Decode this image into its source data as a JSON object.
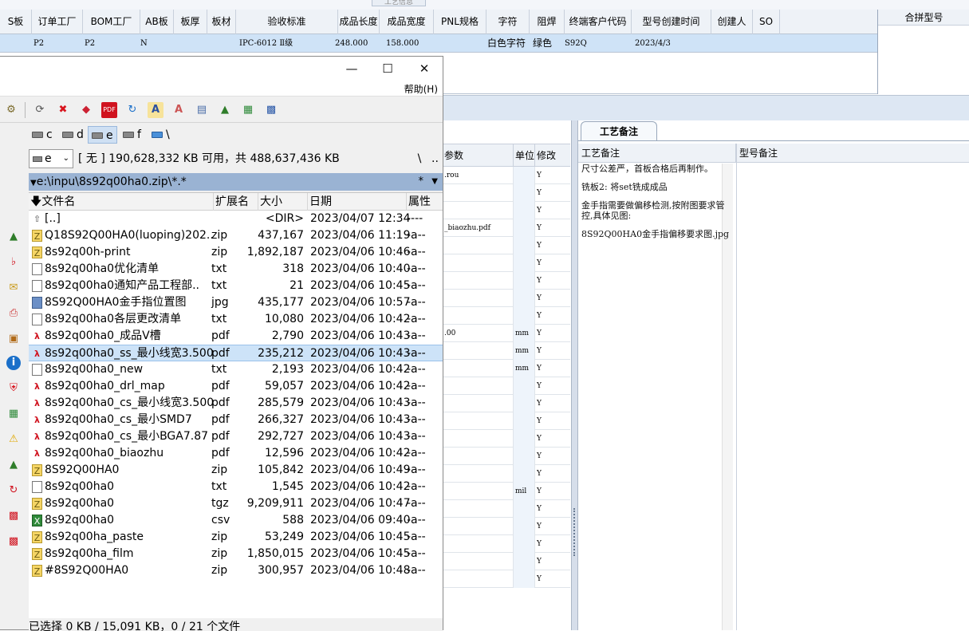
{
  "erp": {
    "top_tab": "工艺信息",
    "headers": [
      {
        "label": "S板"
      },
      {
        "label": "订单工厂"
      },
      {
        "label": "BOM工厂"
      },
      {
        "label": "AB板"
      },
      {
        "label": "板厚"
      },
      {
        "label": "板材"
      },
      {
        "label": "验收标准"
      },
      {
        "label": "成品长度"
      },
      {
        "label": "成品宽度"
      },
      {
        "label": "PNL规格"
      },
      {
        "label": "字符"
      },
      {
        "label": "阻焊"
      },
      {
        "label": "终端客户代码"
      },
      {
        "label": "型号创建时间"
      },
      {
        "label": "创建人"
      },
      {
        "label": "SO"
      }
    ],
    "row": [
      "P2",
      "P2",
      "N",
      "IPC-6012 Ⅱ级",
      "248.000",
      "158.000",
      "白色字符",
      "绿色",
      "S92Q",
      "2023/4/3"
    ],
    "merge_title": "合拼型号",
    "param_headers": {
      "param": "参数",
      "unit": "单位",
      "modify": "修改"
    },
    "param_rows": [
      {
        "p": ".rou",
        "u": "",
        "m": "Y"
      },
      {
        "p": "",
        "u": "",
        "m": "Y"
      },
      {
        "p": "",
        "u": "",
        "m": "Y"
      },
      {
        "p": "_biaozhu.pdf",
        "u": "",
        "m": "Y"
      },
      {
        "p": "",
        "u": "",
        "m": "Y"
      },
      {
        "p": "",
        "u": "",
        "m": "Y"
      },
      {
        "p": "",
        "u": "",
        "m": "Y"
      },
      {
        "p": "",
        "u": "",
        "m": "Y"
      },
      {
        "p": "",
        "u": "",
        "m": "Y"
      },
      {
        "p": ".00",
        "u": "mm",
        "m": "Y"
      },
      {
        "p": "",
        "u": "mm",
        "m": "Y"
      },
      {
        "p": "",
        "u": "mm",
        "m": "Y"
      },
      {
        "p": "",
        "u": "",
        "m": "Y"
      },
      {
        "p": "",
        "u": "",
        "m": "Y"
      },
      {
        "p": "",
        "u": "",
        "m": "Y"
      },
      {
        "p": "",
        "u": "",
        "m": "Y"
      },
      {
        "p": "",
        "u": "",
        "m": "Y"
      },
      {
        "p": "",
        "u": "",
        "m": "Y"
      },
      {
        "p": "",
        "u": "mil",
        "m": "Y"
      },
      {
        "p": "",
        "u": "",
        "m": "Y"
      },
      {
        "p": "",
        "u": "",
        "m": "Y"
      },
      {
        "p": "",
        "u": "",
        "m": "Y"
      },
      {
        "p": "",
        "u": "",
        "m": "Y"
      },
      {
        "p": "",
        "u": "",
        "m": "Y"
      }
    ],
    "notes_tab": "工艺备注",
    "notes_col1": "工艺备注",
    "notes_col2": "型号备注",
    "notes": [
      "尺寸公差严，首板合格后再制作。",
      "铣板2: 将set铣成成品",
      "金手指需要做偏移检测,按附图要求管控,具体见图:",
      "8S92Q00HA0金手指偏移要求图.jpg"
    ]
  },
  "tc": {
    "menu_help": "帮助(H)",
    "drives": [
      {
        "label": "c",
        "active": false
      },
      {
        "label": "d",
        "active": false
      },
      {
        "label": "e",
        "active": true
      },
      {
        "label": "f",
        "active": false
      },
      {
        "label": "\\",
        "active": false
      }
    ],
    "drive_select": "e",
    "free_space": "[ 无 ]  190,628,332 KB 可用，共 488,637,436 KB",
    "root_label": "\\",
    "up_label": "..",
    "path": "e:\\inpu\\8s92q00ha0.zip\\*.*",
    "history_label": "*",
    "columns": {
      "name": "文件名",
      "ext": "扩展名",
      "size": "大小",
      "date": "日期",
      "attr": "属性"
    },
    "files": [
      {
        "icon": "up",
        "name": "[..]",
        "ext": "",
        "size": "<DIR>",
        "date": "2023/04/07 12:34",
        "attr": "----",
        "selected": false
      },
      {
        "icon": "zip",
        "name": "Q18S92Q00HA0(luoping)202..",
        "ext": "zip",
        "size": "437,167",
        "date": "2023/04/06 11:19",
        "attr": "-a--",
        "selected": false
      },
      {
        "icon": "zip",
        "name": "8s92q00h-print",
        "ext": "zip",
        "size": "1,892,187",
        "date": "2023/04/06 10:46",
        "attr": "-a--",
        "selected": false
      },
      {
        "icon": "txt",
        "name": "8s92q00ha0优化清单",
        "ext": "txt",
        "size": "318",
        "date": "2023/04/06 10:40",
        "attr": "-a--",
        "selected": false
      },
      {
        "icon": "txt",
        "name": "8s92q00ha0通知产品工程部..",
        "ext": "txt",
        "size": "21",
        "date": "2023/04/06 10:45",
        "attr": "-a--",
        "selected": false
      },
      {
        "icon": "jpg",
        "name": "8S92Q00HA0金手指位置图",
        "ext": "jpg",
        "size": "435,177",
        "date": "2023/04/06 10:57",
        "attr": "-a--",
        "selected": false
      },
      {
        "icon": "txt",
        "name": "8s92q00ha0各层更改清单",
        "ext": "txt",
        "size": "10,080",
        "date": "2023/04/06 10:42",
        "attr": "-a--",
        "selected": false
      },
      {
        "icon": "pdf",
        "name": "8s92q00ha0_成品V槽",
        "ext": "pdf",
        "size": "2,790",
        "date": "2023/04/06 10:43",
        "attr": "-a--",
        "selected": false
      },
      {
        "icon": "pdf",
        "name": "8s92q00ha0_ss_最小线宽3.500",
        "ext": "pdf",
        "size": "235,212",
        "date": "2023/04/06 10:43",
        "attr": "-a--",
        "selected": true
      },
      {
        "icon": "txt",
        "name": "8s92q00ha0_new",
        "ext": "txt",
        "size": "2,193",
        "date": "2023/04/06 10:42",
        "attr": "-a--",
        "selected": false
      },
      {
        "icon": "pdf",
        "name": "8s92q00ha0_drl_map",
        "ext": "pdf",
        "size": "59,057",
        "date": "2023/04/06 10:42",
        "attr": "-a--",
        "selected": false
      },
      {
        "icon": "pdf",
        "name": "8s92q00ha0_cs_最小线宽3.500",
        "ext": "pdf",
        "size": "285,579",
        "date": "2023/04/06 10:43",
        "attr": "-a--",
        "selected": false
      },
      {
        "icon": "pdf",
        "name": "8s92q00ha0_cs_最小SMD7",
        "ext": "pdf",
        "size": "266,327",
        "date": "2023/04/06 10:43",
        "attr": "-a--",
        "selected": false
      },
      {
        "icon": "pdf",
        "name": "8s92q00ha0_cs_最小BGA7.87",
        "ext": "pdf",
        "size": "292,727",
        "date": "2023/04/06 10:43",
        "attr": "-a--",
        "selected": false
      },
      {
        "icon": "pdf",
        "name": "8s92q00ha0_biaozhu",
        "ext": "pdf",
        "size": "12,596",
        "date": "2023/04/06 10:42",
        "attr": "-a--",
        "selected": false
      },
      {
        "icon": "zip",
        "name": "8S92Q00HA0",
        "ext": "zip",
        "size": "105,842",
        "date": "2023/04/06 10:49",
        "attr": "-a--",
        "selected": false
      },
      {
        "icon": "txt",
        "name": "8s92q00ha0",
        "ext": "txt",
        "size": "1,545",
        "date": "2023/04/06 10:42",
        "attr": "-a--",
        "selected": false
      },
      {
        "icon": "zip",
        "name": "8s92q00ha0",
        "ext": "tgz",
        "size": "9,209,911",
        "date": "2023/04/06 10:47",
        "attr": "-a--",
        "selected": false
      },
      {
        "icon": "csv",
        "name": "8s92q00ha0",
        "ext": "csv",
        "size": "588",
        "date": "2023/04/06 09:40",
        "attr": "-a--",
        "selected": false
      },
      {
        "icon": "zip",
        "name": "8s92q00ha_paste",
        "ext": "zip",
        "size": "53,249",
        "date": "2023/04/06 10:45",
        "attr": "-a--",
        "selected": false
      },
      {
        "icon": "zip",
        "name": "8s92q00ha_film",
        "ext": "zip",
        "size": "1,850,015",
        "date": "2023/04/06 10:45",
        "attr": "-a--",
        "selected": false
      },
      {
        "icon": "zip",
        "name": "#8S92Q00HA0",
        "ext": "zip",
        "size": "300,957",
        "date": "2023/04/06 10:48",
        "attr": "-a--",
        "selected": false
      }
    ],
    "status": "已选择 0 KB / 15,091 KB，0 / 21 个文件"
  }
}
